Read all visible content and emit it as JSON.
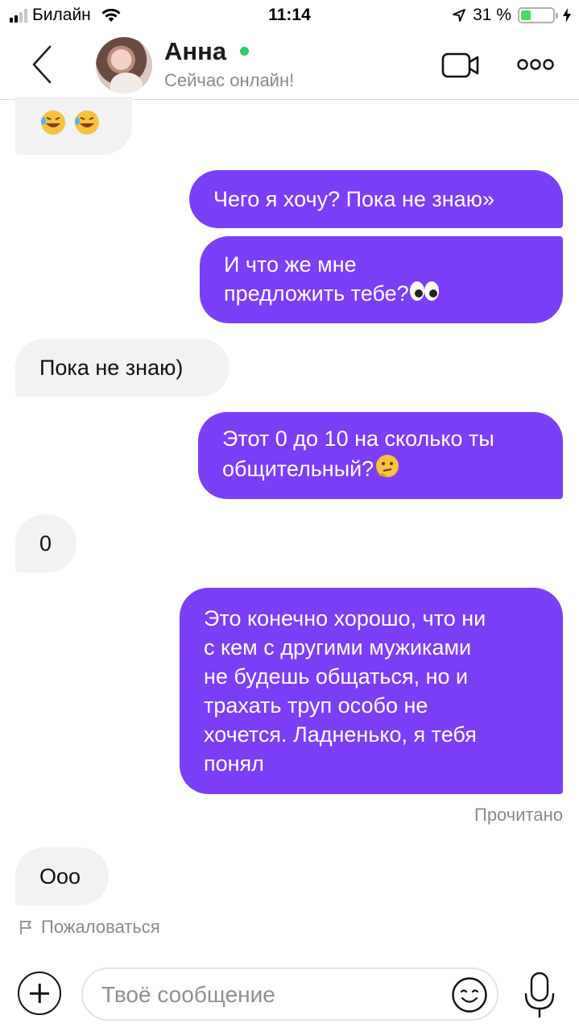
{
  "status_bar": {
    "carrier": "Билайн",
    "time": "11:14",
    "battery_percent": "31 %",
    "battery_level": 0.31,
    "icons": [
      "signal-icon",
      "wifi-icon",
      "location-arrow-icon",
      "battery-icon",
      "charging-bolt-icon"
    ]
  },
  "header": {
    "contact_name": "Анна",
    "contact_status": "Сейчас онлайн!",
    "online_color": "#2fc96a",
    "icons": [
      "back-chevron-icon",
      "video-camera-icon",
      "more-dots-icon"
    ]
  },
  "colors": {
    "outgoing_bubble": "#7b3ff7",
    "incoming_bubble": "#f2f2f2",
    "secondary_text": "#8a8a8a"
  },
  "messages": [
    {
      "direction": "in",
      "text": "",
      "emoji": [
        "rolling-on-floor-laughing",
        "rolling-on-floor-laughing"
      ]
    },
    {
      "direction": "out",
      "text": "Чего я хочу? Пока не знаю»"
    },
    {
      "direction": "out",
      "text": "И что же мне\nпредложить тебе?",
      "emoji": [
        "eyes"
      ]
    },
    {
      "direction": "in",
      "text": "Пока не знаю)"
    },
    {
      "direction": "out",
      "text": "Этот 0 до 10 на сколько ты\nобщительный?",
      "emoji": [
        "thinking-face"
      ]
    },
    {
      "direction": "in",
      "text": "0"
    },
    {
      "direction": "out",
      "text": "Это конечно хорошо, что ни\nс кем с другими мужиками\nне будешь общаться, но и\nтрахать труп особо не\nхочется. Ладненько, я тебя\nпонял"
    },
    {
      "direction": "in",
      "text": "Ооо"
    }
  ],
  "read_receipt": "Прочитано",
  "report_label": "Пожаловаться",
  "composer": {
    "placeholder": "Твоё сообщение",
    "icons": [
      "plus-circle-icon",
      "smile-icon",
      "microphone-icon"
    ]
  }
}
